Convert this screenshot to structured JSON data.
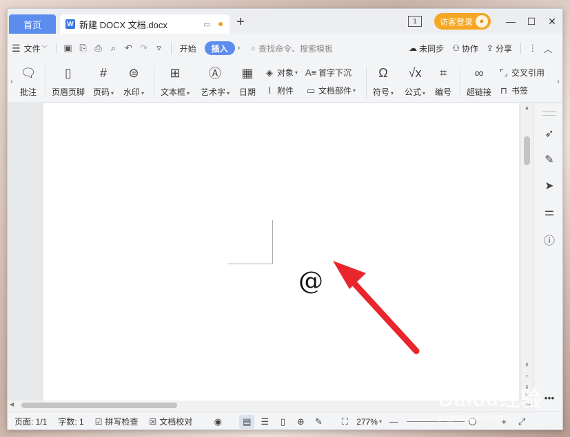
{
  "titlebar": {
    "home_tab": "首页",
    "doc_tab": "新建 DOCX 文档.docx",
    "doc_icon": "W",
    "new_tab": "+",
    "badge": "1",
    "login": "访客登录"
  },
  "menubar": {
    "file": "文件",
    "start": "开始",
    "insert": "插入",
    "search_placeholder": "查找命令、搜索模板",
    "sync": "未同步",
    "collab": "协作",
    "share": "分享"
  },
  "ribbon": {
    "comment": "批注",
    "header_footer": "页眉页脚",
    "page_number": "页码",
    "watermark": "水印",
    "textbox": "文本框",
    "wordart": "艺术字",
    "date": "日期",
    "object": "对象",
    "attachment": "附件",
    "drop_cap": "首字下沉",
    "doc_parts": "文档部件",
    "symbol": "符号",
    "formula": "公式",
    "numbering": "编号",
    "hyperlink": "超链接",
    "cross_ref": "交叉引用",
    "bookmark": "书签"
  },
  "document": {
    "content": "@"
  },
  "statusbar": {
    "page": "页面: 1/1",
    "word_count": "字数: 1",
    "spell_check": "拼写检查",
    "proofread": "文档校对",
    "zoom": "277%"
  },
  "watermark": {
    "brand": "Baidu经验",
    "url": "jingyan.baidu.com"
  },
  "colors": {
    "accent": "#5b8def",
    "login": "#f5a623",
    "arrow": "#e8262c"
  }
}
